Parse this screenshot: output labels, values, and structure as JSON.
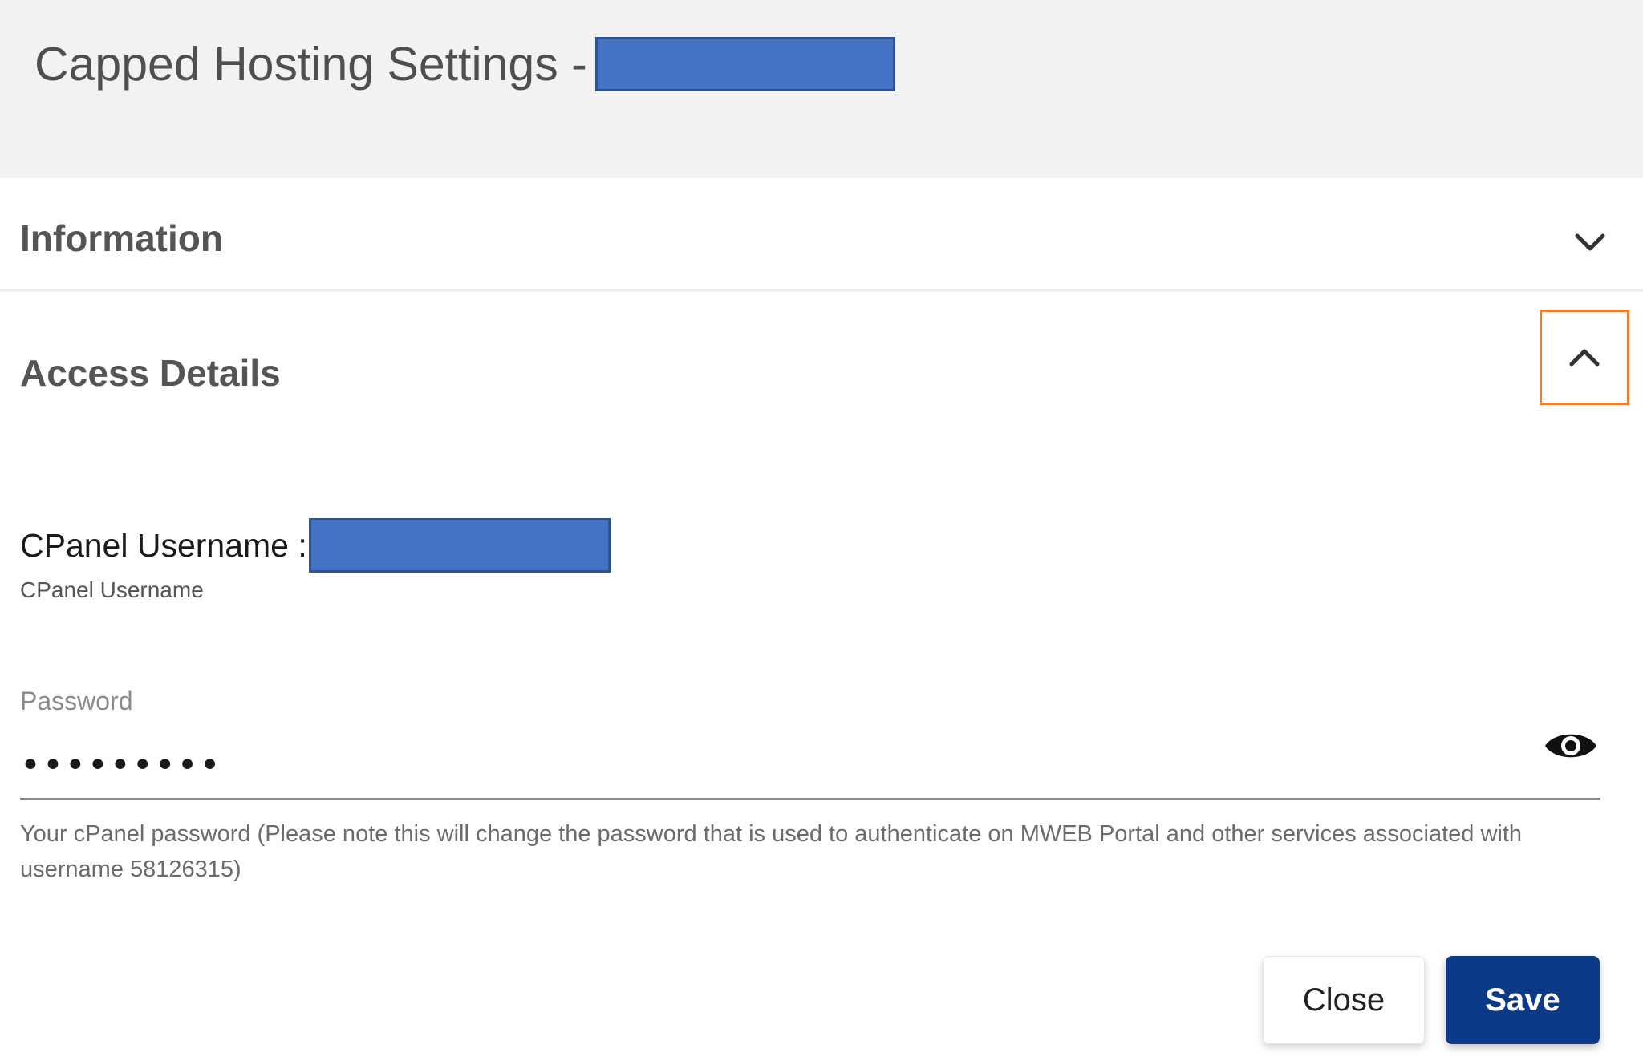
{
  "header": {
    "title": "Capped Hosting Settings -"
  },
  "sections": {
    "information": {
      "title": "Information",
      "icon": "chevron-down-icon"
    },
    "access_details": {
      "title": "Access Details",
      "icon": "chevron-up-icon",
      "cpanel_username_label": "CPanel Username :",
      "cpanel_username_hint": "CPanel Username",
      "password_label": "Password",
      "password_value": "•••••••••",
      "password_toggle_icon": "eye-icon",
      "password_hint": "Your cPanel password (Please note this will change the password that is used to authenticate on MWEB Portal and other services associated with username 58126315)"
    }
  },
  "actions": {
    "close_label": "Close",
    "save_label": "Save"
  },
  "colors": {
    "header_bg": "#f2f2f2",
    "redaction": "#4472c4",
    "focus_outline": "#ed7d31",
    "save_button": "#0d3a86"
  }
}
